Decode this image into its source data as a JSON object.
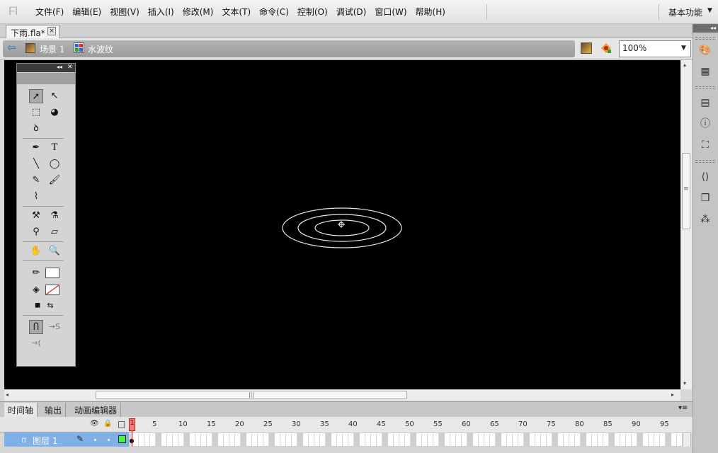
{
  "app": {
    "logo": "Fl"
  },
  "menu": [
    "文件(F)",
    "编辑(E)",
    "视图(V)",
    "插入(I)",
    "修改(M)",
    "文本(T)",
    "命令(C)",
    "控制(O)",
    "调试(D)",
    "窗口(W)",
    "帮助(H)"
  ],
  "workspace": {
    "label": "基本功能",
    "arrow": "▼"
  },
  "document": {
    "tab": "下雨.fla*",
    "close": "×"
  },
  "breadcrumb": {
    "back": "⇦",
    "scene": "场景 1",
    "symbol": "水波纹"
  },
  "zoom": {
    "value": "100%",
    "arrow": "▼"
  },
  "stage": {
    "background": "#000000",
    "ellipse_color": "#e8e8e8",
    "ellipses": 3,
    "registration": "⌖"
  },
  "tools_panel": {
    "collapse": "◂◂",
    "close": "✕",
    "rows": [
      [
        "➚",
        "↖"
      ],
      [
        "⬚",
        "◕"
      ],
      [
        "ꝺ"
      ],
      [
        "✒",
        "T"
      ],
      [
        "╲",
        "◯"
      ],
      [
        "✎",
        "🖌"
      ],
      [
        "⌇"
      ],
      [
        "⚒",
        "⚗"
      ],
      [
        "⚲",
        "▱"
      ],
      [
        "✋",
        "🔍"
      ]
    ],
    "stroke_icon": "✏",
    "fill_icon": "◈",
    "swap_icons": [
      "◼",
      "⇆"
    ],
    "option_icons": [
      "Ⴖ",
      "→S",
      "→("
    ]
  },
  "right_dock": {
    "collapse": "◂◂",
    "icons": [
      "🎨",
      "▦",
      "▤",
      "ⓘ",
      "⛶",
      "⟨⟩",
      "❒",
      "⁂"
    ]
  },
  "timeline": {
    "tabs": [
      "时间轴",
      "输出",
      "动画编辑器"
    ],
    "menu_icon": "▾≡",
    "header_icons": [
      "👁",
      "🔒",
      "□"
    ],
    "ruler": [
      "1",
      "5",
      "10",
      "15",
      "20",
      "25",
      "30",
      "35",
      "40",
      "45",
      "50",
      "55",
      "60",
      "65",
      "70",
      "75",
      "80",
      "85",
      "90",
      "95"
    ],
    "playhead_frame": "1",
    "layer": {
      "name": "图层 1",
      "icon": "▫",
      "pencil": "✎",
      "color": "#4cf04c"
    }
  },
  "scroll": {
    "left": "◂",
    "right": "▸",
    "up": "▴",
    "down": "▾",
    "grip": "|||",
    "vgrip": "≡"
  }
}
